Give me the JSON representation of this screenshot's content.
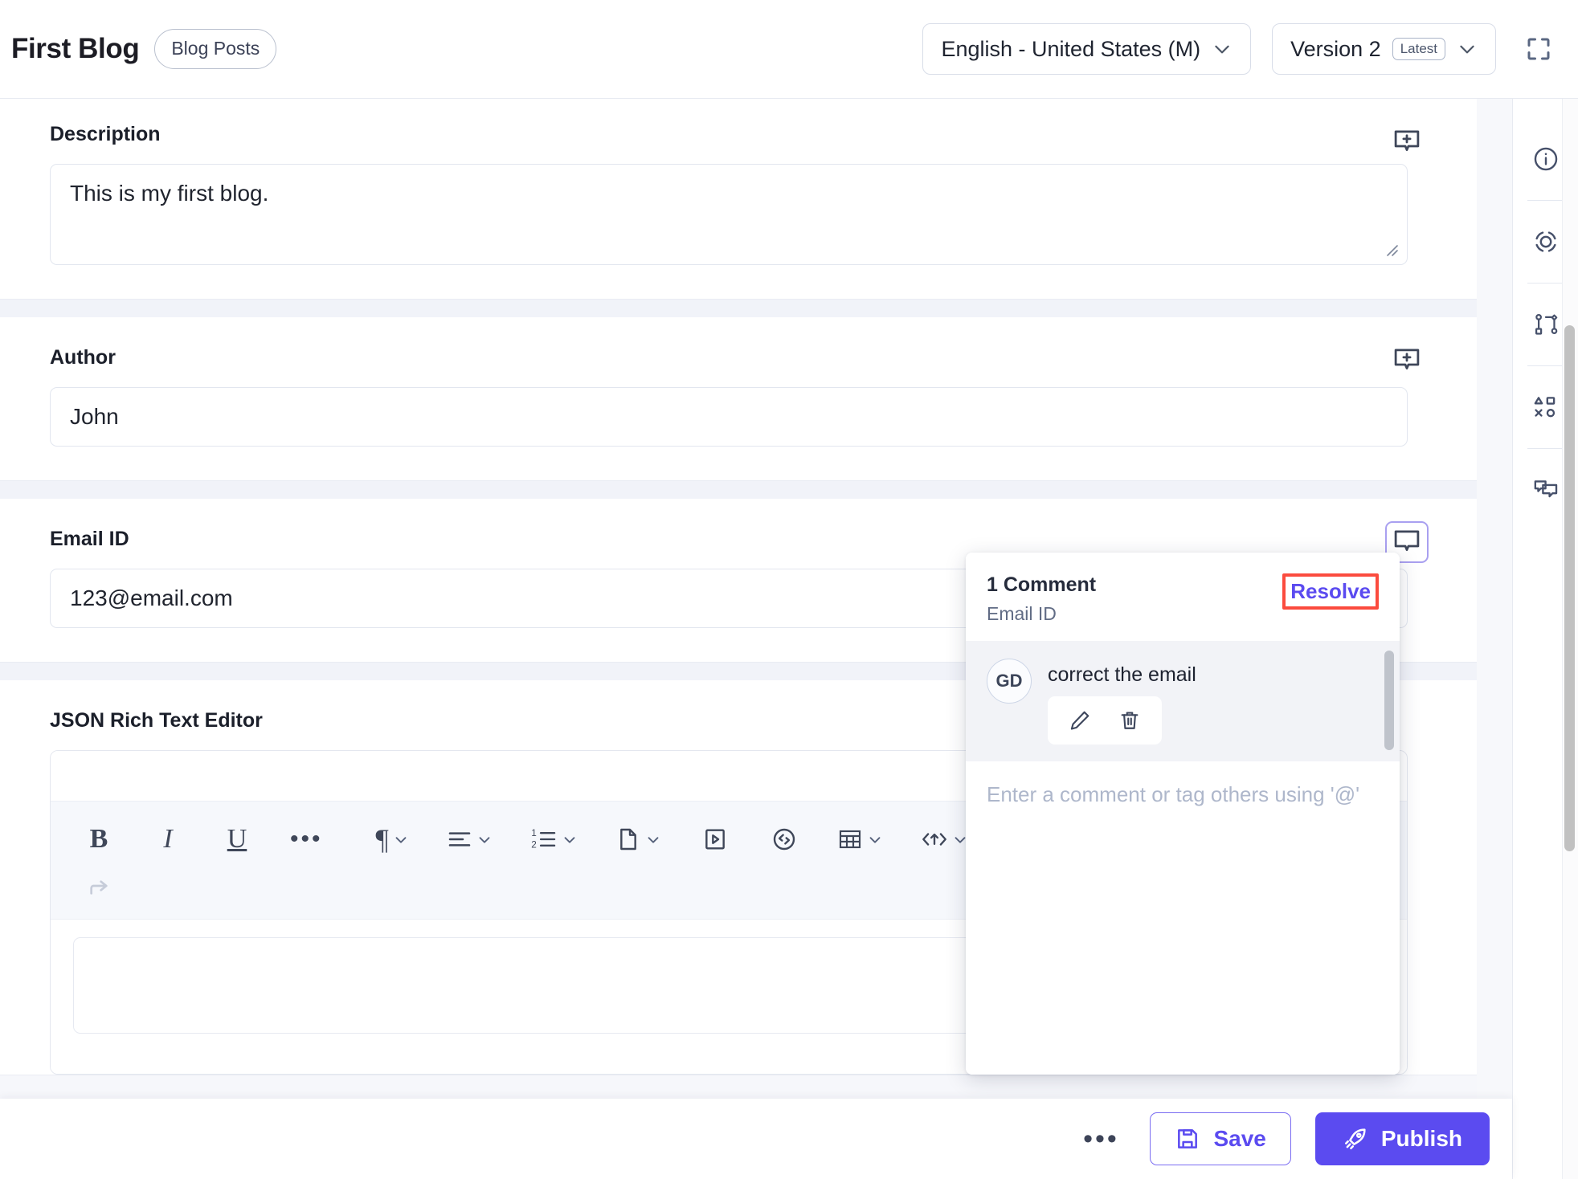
{
  "header": {
    "title": "First Blog",
    "content_type_chip": "Blog Posts",
    "locale_select": "English - United States (M)",
    "version_select": "Version 2",
    "version_badge": "Latest",
    "expand_icon": "fullscreen-icon"
  },
  "rail": {
    "items": [
      {
        "name": "info-icon",
        "label": "Info"
      },
      {
        "name": "focus-icon",
        "label": "Focus"
      },
      {
        "name": "references-icon",
        "label": "References"
      },
      {
        "name": "assets-icon",
        "label": "Assets"
      },
      {
        "name": "comments-icon",
        "label": "Comments"
      }
    ]
  },
  "fields": {
    "description": {
      "label": "Description",
      "value": "This is my first blog."
    },
    "author": {
      "label": "Author",
      "value": "John"
    },
    "email": {
      "label": "Email ID",
      "value": "123@email.com"
    },
    "rich_text": {
      "label": "JSON Rich Text Editor",
      "value": ""
    }
  },
  "editor_toolbar": {
    "bold": "B",
    "italic": "I",
    "underline": "U",
    "more": "•••",
    "paragraph": "¶",
    "align": "align-left-icon",
    "ordered_list": "ordered-list-icon",
    "file": "file-icon",
    "video": "video-icon",
    "code": "code-circle-icon",
    "table": "table-icon",
    "embed": "embed-code-icon",
    "redo": "redo-icon"
  },
  "comment_popup": {
    "count_title": "1 Comment",
    "field_name": "Email ID",
    "resolve_label": "Resolve",
    "comments": [
      {
        "avatar_initials": "GD",
        "text": "correct the email",
        "edit_icon": "pencil-icon",
        "delete_icon": "trash-icon"
      }
    ],
    "compose_placeholder": "Enter a comment or tag others using '@'"
  },
  "actions": {
    "more_label": "•••",
    "save_label": "Save",
    "publish_label": "Publish",
    "accent_color": "#5b4bf0",
    "highlight_color": "#fb4b3e"
  }
}
